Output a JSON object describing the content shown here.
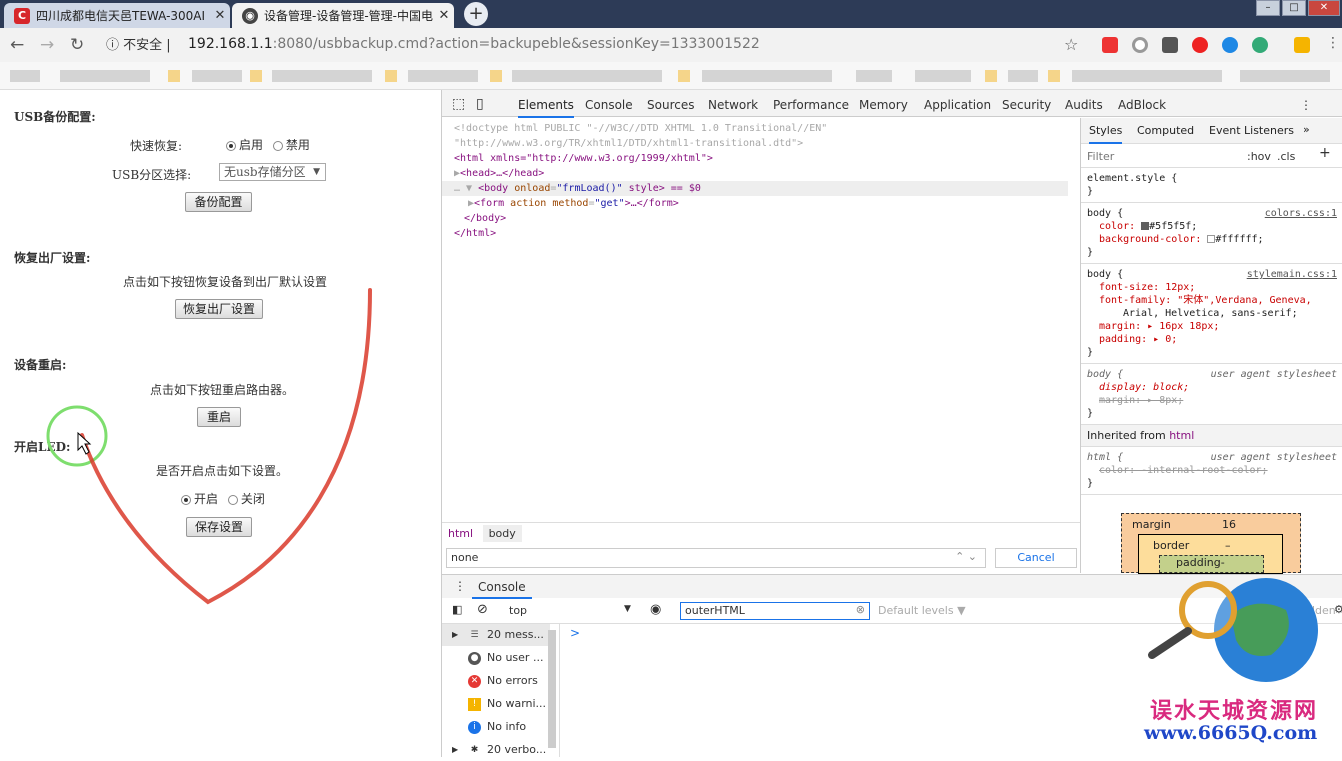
{
  "browser": {
    "tabs": [
      {
        "title": "四川成都电信天邑TEWA-300AI"
      },
      {
        "title": "设备管理-设备管理-管理-中国电"
      }
    ],
    "security_label": "不安全",
    "url_host": "192.168.1.1",
    "url_path": ":8080/usbbackup.cmd?action=backupeble&sessionKey=1333001522"
  },
  "page": {
    "usb_section": "USB备份配置:",
    "quick_restore_label": "快速恢复:",
    "enable_label": "启用",
    "disable_label": "禁用",
    "usb_partition_label": "USB分区选择:",
    "usb_partition_value": "无usb存储分区",
    "backup_button": "备份配置",
    "factory_section": "恢复出厂设置:",
    "factory_desc": "点击如下按钮恢复设备到出厂默认设置",
    "factory_button": "恢复出厂设置",
    "reboot_section": "设备重启:",
    "reboot_desc": "点击如下按钮重启路由器。",
    "reboot_button": "重启",
    "led_section": "开启LED:",
    "led_desc": "是否开启点击如下设置。",
    "led_on": "开启",
    "led_off": "关闭",
    "save_button": "保存设置"
  },
  "devtools": {
    "tabs": [
      "Elements",
      "Console",
      "Sources",
      "Network",
      "Performance",
      "Memory",
      "Application",
      "Security",
      "Audits",
      "AdBlock"
    ],
    "dom": {
      "doctype1": "<!doctype html PUBLIC \"-//W3C//DTD XHTML 1.0 Transitional//EN\"",
      "doctype2": "\"http://www.w3.org/TR/xhtml1/DTD/xhtml1-transitional.dtd\">",
      "html_open": "<html xmlns=\"http://www.w3.org/1999/xhtml\">",
      "head": "<head>…</head>",
      "body_tag": "<body",
      "body_attr": "onload",
      "body_val": "\"frmLoad()\"",
      "body_rest": " style> == $0",
      "form_tag": "<form",
      "form_attr": "action method",
      "form_val": "\"get\"",
      "form_rest": ">…</form>",
      "body_close": "</body>",
      "html_close": "</html>"
    },
    "styles_tabs": [
      "Styles",
      "Computed",
      "Event Listeners"
    ],
    "filter_placeholder": "Filter",
    "hov": ":hov",
    "cls": ".cls",
    "rules": {
      "element_style": "element.style {",
      "close": "}",
      "body_sel": "body {",
      "src1": "colors.css:1",
      "color_prop": "color: ",
      "color_val": "#5f5f5f;",
      "bg_prop": "background-color: ",
      "bg_val": "#ffffff;",
      "src2": "stylemain.css:1",
      "fs": "font-size: 12px;",
      "ff": "font-family: \"宋体\",Verdana, Geneva,",
      "ff2": "Arial, Helvetica, sans-serif;",
      "margin": "margin: ▸ 16px 18px;",
      "padding": "padding: ▸ 0;",
      "ua_body": "body {",
      "ua_src": "user agent stylesheet",
      "display": "display: block;",
      "margin_ua": "margin: ▸ 8px;",
      "inherited": "Inherited from",
      "inherited_el": "html",
      "html_sel": "html {",
      "html_color": "color: -internal-root-color;"
    },
    "box": {
      "margin": "margin",
      "margin_val": "16",
      "border": "border",
      "border_val": "–",
      "padding": "padding-"
    },
    "crumbs": [
      "html",
      "body"
    ],
    "search_value": "none",
    "cancel": "Cancel",
    "console_tab": "Console",
    "context": "top",
    "filter_value": "outerHTML",
    "levels": "Default levels ▼",
    "hidden": "dden",
    "sidebar": [
      {
        "label": "20 mess...",
        "icon": "list-icon"
      },
      {
        "label": "No user ...",
        "icon": "user-icon"
      },
      {
        "label": "No errors",
        "icon": "error-icon"
      },
      {
        "label": "No warni...",
        "icon": "warning-icon"
      },
      {
        "label": "No info",
        "icon": "info-icon"
      },
      {
        "label": "20 verbo...",
        "icon": "bug-icon"
      }
    ],
    "prompt": ">"
  },
  "watermark": {
    "text": "误水天城资源网",
    "url": "www.6665Q.com"
  }
}
